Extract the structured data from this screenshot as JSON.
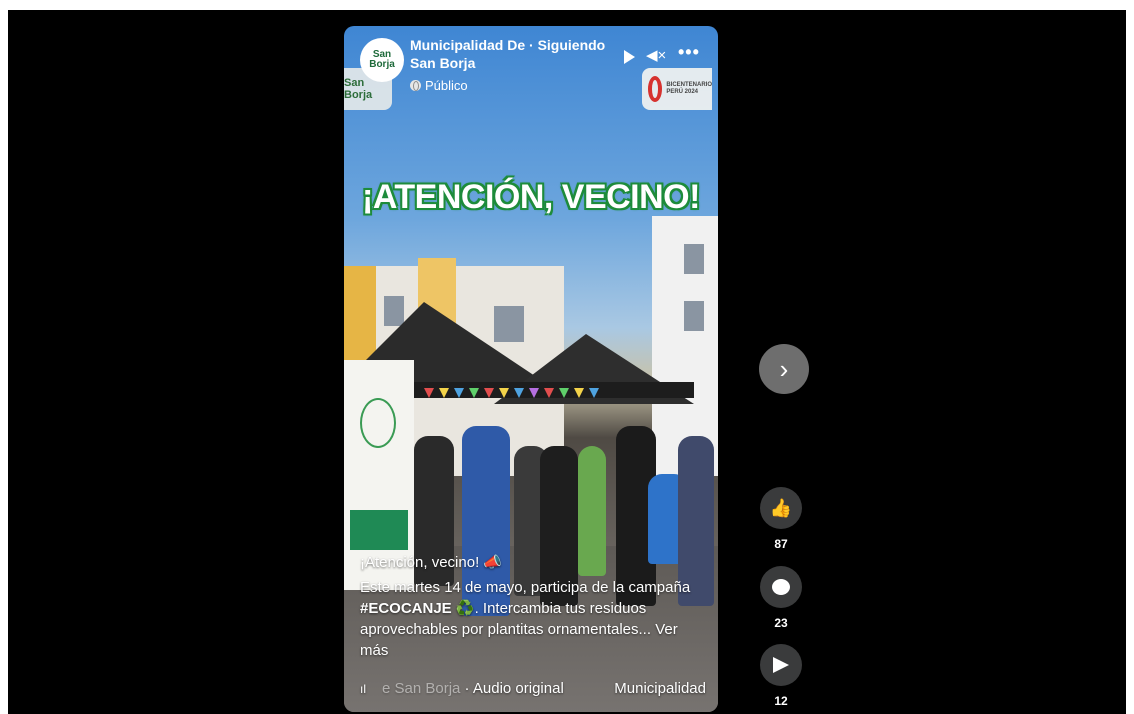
{
  "header": {
    "page_name": "Municipalidad De · Siguiendo San Borja",
    "privacy": "Público",
    "avatar_text": "San Borja",
    "logo_badge": "San Borja",
    "bicentenario_text": "BICENTENARIO PERÚ 2024"
  },
  "overlay": {
    "headline": "¡ATENCIÓN, VECINO!"
  },
  "caption": {
    "line1": "¡Atención, vecino! 📣",
    "body": "Este martes 14 de mayo, participa de la campaña ",
    "hashtag": "#ECOCANJE",
    "emoji": " ♻️",
    "body2": ". Intercambia tus residuos aprovechables por plantitas ornamentales... ",
    "more": "Ver más"
  },
  "audio": {
    "faded_prefix": "e San Borja",
    "label": " · Audio original",
    "author": "Municipalidad"
  },
  "actions": {
    "likes": "87",
    "comments": "23",
    "shares": "12"
  },
  "icons": {
    "next": "chevron-right-icon",
    "like": "thumbs-up-icon",
    "comment": "comment-icon",
    "share": "share-icon",
    "play": "play-icon",
    "mute": "mute-icon",
    "more": "more-icon"
  },
  "colors": {
    "headline_outline": "#1f8c3c",
    "background": "#000000",
    "action_circle": "#3a3b3c"
  }
}
